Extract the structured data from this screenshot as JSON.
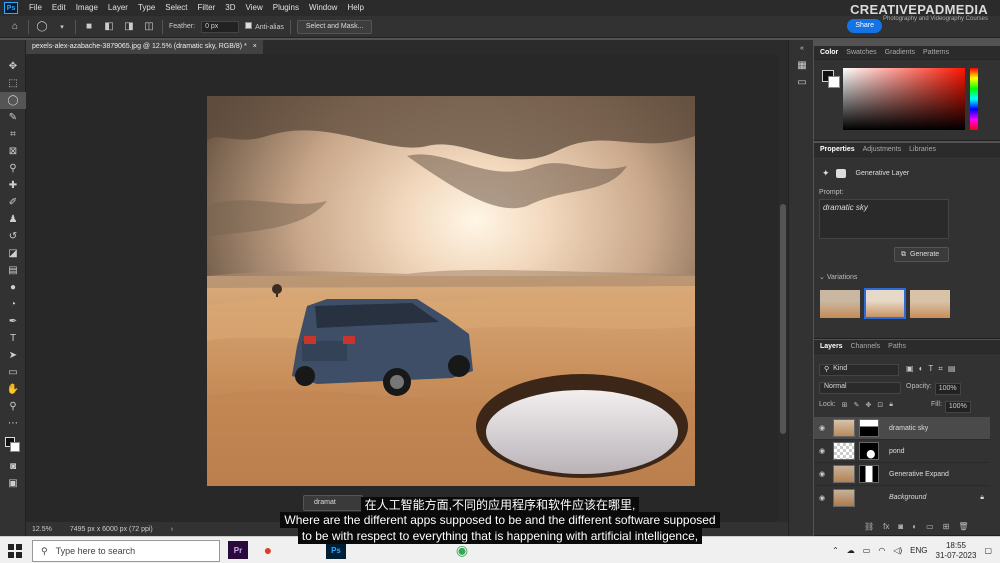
{
  "app": {
    "logo": "Ps"
  },
  "menu": [
    "File",
    "Edit",
    "Image",
    "Layer",
    "Type",
    "Select",
    "Filter",
    "3D",
    "View",
    "Plugins",
    "Window",
    "Help"
  ],
  "options_bar": {
    "feather_label": "Feather:",
    "feather_value": "0 px",
    "anti_alias_label": "Anti-alias",
    "select_mask_label": "Select and Mask...",
    "share_label": "Share"
  },
  "watermark": {
    "title": "CREATIVEPADMEDIA",
    "subtitle": "Photography and Videography Courses"
  },
  "document": {
    "tab_title": "pexels-alex-azabache-3879065.jpg @ 12.5% (dramatic sky, RGB/8) *",
    "close": "×",
    "zoom": "12.5%",
    "doc_size": "7495 px x 6000 px (72 ppi)",
    "context_label": "dramat"
  },
  "color_panel": {
    "tabs": [
      "Color",
      "Swatches",
      "Gradients",
      "Patterns"
    ],
    "active": "Color"
  },
  "properties": {
    "tabs": [
      "Properties",
      "Adjustments",
      "Libraries"
    ],
    "active": "Properties",
    "layer_type": "Generative Layer",
    "prompt_label": "Prompt:",
    "prompt_value": "dramatic sky",
    "generate_label": "Generate",
    "variations_label": "Variations",
    "selected_variation": 2
  },
  "layers_panel": {
    "tabs": [
      "Layers",
      "Channels",
      "Paths"
    ],
    "active": "Layers",
    "filter_kind": "Kind",
    "blend_mode": "Normal",
    "opacity_label": "Opacity:",
    "opacity_value": "100%",
    "lock_label": "Lock:",
    "fill_label": "Fill:",
    "fill_value": "100%",
    "layers": [
      {
        "name": "dramatic sky",
        "selected": true
      },
      {
        "name": "pond",
        "selected": false
      },
      {
        "name": "Generative Expand",
        "selected": false
      },
      {
        "name": "Background",
        "selected": false,
        "italic": true
      }
    ]
  },
  "subtitles": {
    "chinese": "在人工智能方面,不同的应用程序和软件应该在哪里,",
    "english_line1": "Where are the different apps supposed to be and the different software supposed",
    "english_line2": "to be with respect to everything that is happening with artificial intelligence,"
  },
  "taskbar": {
    "search_placeholder": "Type here to search",
    "language": "ENG",
    "time": "18:55",
    "date": "31-07-2023"
  },
  "colors": {
    "accent_blue": "#1473e6",
    "ps_blue": "#31a8ff",
    "variation_selected": "#2f6bd8"
  }
}
